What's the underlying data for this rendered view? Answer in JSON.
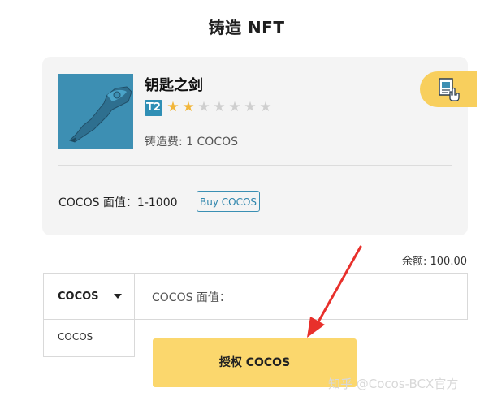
{
  "page": {
    "title": "铸造 NFT"
  },
  "nft": {
    "name": "钥匙之剑",
    "tier": "T2",
    "rating": {
      "filled": 2,
      "total": 8
    },
    "fee_text": "铸造费: 1 COCOS",
    "face_value_text": "COCOS 面值：1-1000",
    "buy_button_label": "Buy COCOS",
    "image_icon": "sword-key-image",
    "corner_icon": "file-hand-icon"
  },
  "balance_text": "余额: 100.00",
  "token_select": {
    "selected": "COCOS",
    "options": [
      "COCOS"
    ]
  },
  "amount_input": {
    "label": "COCOS 面值："
  },
  "authorize_button_label": "授权 COCOS",
  "watermark": "知乎 @Cocos-BCX官方",
  "colors": {
    "accent_yellow": "#fbd76d",
    "tier_blue": "#2f8fb5",
    "arrow_red": "#e8302b",
    "star_gold": "#f2b63a"
  }
}
